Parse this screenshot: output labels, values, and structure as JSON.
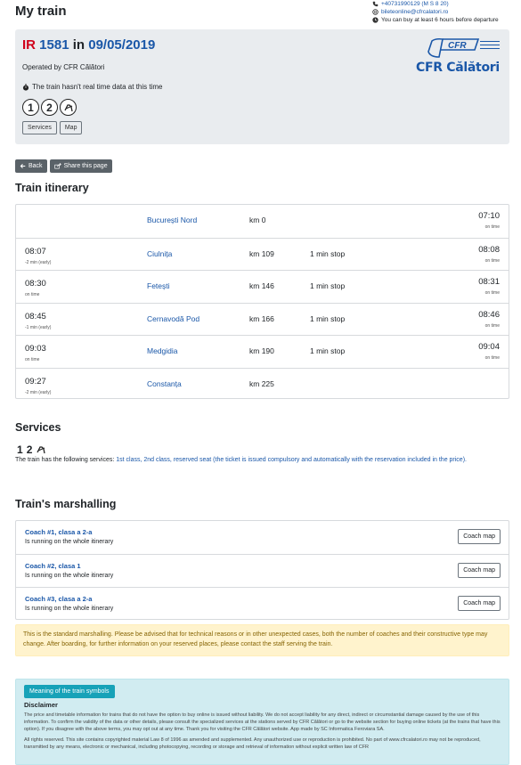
{
  "header": {
    "title": "My train",
    "phone": "+40731990129 (M S 8 20)",
    "email": "bileteonline@cfrcalatori.ro",
    "buy_notice": "You can buy at least 6 hours before departure"
  },
  "train": {
    "category": "IR",
    "number": "1581",
    "in_word": "in",
    "date": "09/05/2019",
    "operator": "Operated by CFR Călători",
    "realtime_notice": "The train hasn't real time data at this time",
    "symbols": [
      "1",
      "2",
      "reserved"
    ],
    "tabs": [
      "Services",
      "Map"
    ],
    "logo_tagline": "CFR",
    "logo_text": "CFR Călători"
  },
  "buttons": {
    "back": "Back",
    "share": "Share this page"
  },
  "itinerary": {
    "title": "Train itinerary",
    "rows": [
      {
        "arr": "",
        "arr_delay": "",
        "station": "București Nord",
        "km": "km 0",
        "stop": "",
        "dep": "07:10",
        "dep_delay": "on time"
      },
      {
        "arr": "08:07",
        "arr_delay": "-2 min (early)",
        "station": "Ciulnița",
        "km": "km 109",
        "stop": "1 min stop",
        "dep": "08:08",
        "dep_delay": "on time"
      },
      {
        "arr": "08:30",
        "arr_delay": "on time",
        "station": "Fetești",
        "km": "km 146",
        "stop": "1 min stop",
        "dep": "08:31",
        "dep_delay": "on time"
      },
      {
        "arr": "08:45",
        "arr_delay": "-1 min (early)",
        "station": "Cernavodă Pod",
        "km": "km 166",
        "stop": "1 min stop",
        "dep": "08:46",
        "dep_delay": "on time"
      },
      {
        "arr": "09:03",
        "arr_delay": "on time",
        "station": "Medgidia",
        "km": "km 190",
        "stop": "1 min stop",
        "dep": "09:04",
        "dep_delay": "on time"
      },
      {
        "arr": "09:27",
        "arr_delay": "-2 min (early)",
        "station": "Constanța",
        "km": "km 225",
        "stop": "",
        "dep": "",
        "dep_delay": ""
      }
    ]
  },
  "services": {
    "title": "Services",
    "icons": [
      "1",
      "2",
      "reserved-seat"
    ],
    "text_before": "The train has the following services: ",
    "text_highlight": "1st class, 2nd class, reserved seat (the ticket is issued compulsory and automatically with the reservation included in the price)."
  },
  "marshalling": {
    "title": "Train's marshalling",
    "coaches": [
      {
        "title": "Coach #1, clasa a 2-a",
        "sub": "Is running on the whole itinerary",
        "btn": "Coach map"
      },
      {
        "title": "Coach #2, clasa 1",
        "sub": "Is running on the whole itinerary",
        "btn": "Coach map"
      },
      {
        "title": "Coach #3, clasa a 2-a",
        "sub": "Is running on the whole itinerary",
        "btn": "Coach map"
      }
    ],
    "warning": "This is the standard marshalling. Please be advised that for technical reasons or in other unexpected cases, both the number of coaches and their constructive type may change. After boarding, for further information on your reserved places, please contact the staff serving the train."
  },
  "info": {
    "button": "Meaning of the train symbols",
    "disclaimer_title": "Disclaimer",
    "disclaimer_text": "The price and timetable information for trains that do not have the option to buy online is issued without liability. We do not accept liability for any direct, indirect or circumstantial damage caused by the use of this information. To confirm the validity of the data or other details, please consult the specialized services at the stations served by CFR Călători or go to the website section for buying online tickets (at the trains that have this option). If you disagree with the above terms, you may opt out at any time. Thank you for visiting the CFR Călători website. App made by SC Informatica Feroviara SA.",
    "rights_text": "All rights reserved. This site contains copyrighted material Law 8 of 1996 as amended and supplemented. Any unauthorized use or reproduction is prohibited. No part of www.cfrcalatori.ro may not be reproduced, transmitted by any means, electronic or mechanical, including photocopying, recording or storage and retrieval of information without explicit written law of CFR"
  },
  "colors": {
    "accent": "#1a57a8",
    "category": "#d0021b",
    "card_bg": "#e9ecef",
    "warning_bg": "#fff3cd",
    "info_bg": "#d1ecf1",
    "info_button": "#17a2b8"
  }
}
